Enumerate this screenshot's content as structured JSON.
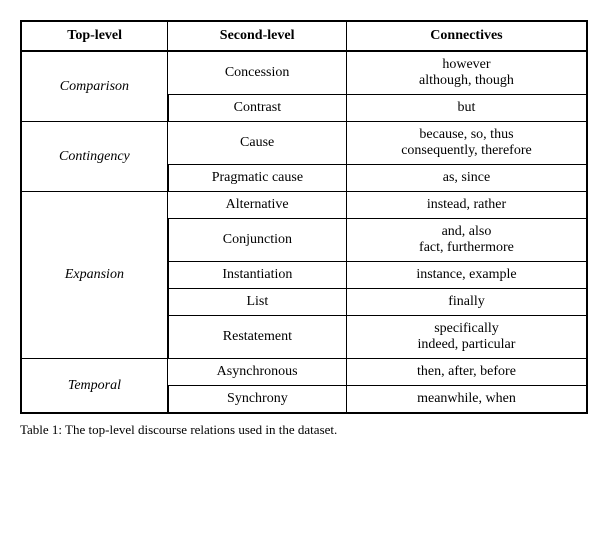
{
  "table": {
    "caption": "Table 1: The top-level discourse relations used in the dataset.",
    "headers": [
      "Top-level",
      "Second-level",
      "Connectives"
    ],
    "rows": [
      {
        "top_level": "Comparison",
        "top_level_rowspan": 2,
        "second_level": "Concession",
        "connectives": "however\nalthough, though"
      },
      {
        "top_level": "",
        "second_level": "Contrast",
        "connectives": "but"
      },
      {
        "top_level": "Contingency",
        "top_level_rowspan": 2,
        "second_level": "Cause",
        "connectives": "because, so, thus\nconsequently, therefore"
      },
      {
        "top_level": "",
        "second_level": "Pragmatic cause",
        "connectives": "as, since"
      },
      {
        "top_level": "Expansion",
        "top_level_rowspan": 5,
        "second_level": "Alternative",
        "connectives": "instead, rather"
      },
      {
        "top_level": "",
        "second_level": "Conjunction",
        "connectives": "and, also\nfact, furthermore"
      },
      {
        "top_level": "",
        "second_level": "Instantiation",
        "connectives": "instance, example"
      },
      {
        "top_level": "",
        "second_level": "List",
        "connectives": "finally"
      },
      {
        "top_level": "",
        "second_level": "Restatement",
        "connectives": "specifically\nindeed, particular"
      },
      {
        "top_level": "Temporal",
        "top_level_rowspan": 2,
        "second_level": "Asynchronous",
        "connectives": "then, after, before"
      },
      {
        "top_level": "",
        "second_level": "Synchrony",
        "connectives": "meanwhile, when"
      }
    ]
  }
}
